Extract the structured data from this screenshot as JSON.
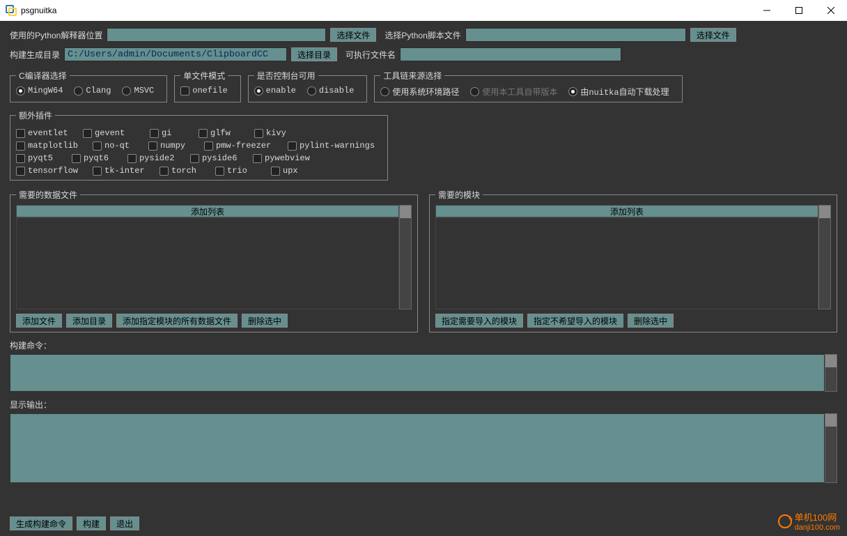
{
  "window": {
    "title": "psgnuitka"
  },
  "row1": {
    "python_label": "使用的Python解释器位置",
    "browse1": "选择文件",
    "script_label": "选择Python脚本文件",
    "browse2": "选择文件"
  },
  "row2": {
    "outdir_label": "构建生成目录",
    "outdir_value": "C:/Users/admin/Documents/ClipboardCC",
    "browse_dir": "选择目录",
    "exe_label": "可执行文件名"
  },
  "compiler": {
    "legend": "C编译器选择",
    "opt1": "MingW64",
    "opt2": "Clang",
    "opt3": "MSVC"
  },
  "onefile": {
    "legend": "单文件模式",
    "opt": "onefile"
  },
  "console": {
    "legend": "是否控制台可用",
    "opt1": "enable",
    "opt2": "disable"
  },
  "toolchain": {
    "legend": "工具链来源选择",
    "opt1": "使用系统环境路径",
    "opt2": "使用本工具自带版本",
    "opt3": "由nuitka自动下载处理"
  },
  "plugins": {
    "legend": "额外插件",
    "r1": [
      "eventlet",
      "gevent",
      "gi",
      "glfw",
      "kivy"
    ],
    "r2": [
      "matplotlib",
      "no-qt",
      "numpy",
      "pmw-freezer",
      "pylint-warnings"
    ],
    "r3": [
      "pyqt5",
      "pyqt6",
      "pyside2",
      "pyside6",
      "pywebview"
    ],
    "r4": [
      "tensorflow",
      "tk-inter",
      "torch",
      "trio",
      "upx"
    ]
  },
  "datafiles": {
    "legend": "需要的数据文件",
    "header": "添加列表",
    "b1": "添加文件",
    "b2": "添加目录",
    "b3": "添加指定模块的所有数据文件",
    "b4": "删除选中"
  },
  "modules": {
    "legend": "需要的模块",
    "header": "添加列表",
    "b1": "指定需要导入的模块",
    "b2": "指定不希望导入的模块",
    "b3": "删除选中"
  },
  "build_cmd_label": "构建命令：",
  "output_label": "显示输出：",
  "footer": {
    "gen": "生成构建命令",
    "build": "构建",
    "exit": "退出"
  },
  "watermark": {
    "line1": "单机100网",
    "line2": "danji100.com"
  }
}
